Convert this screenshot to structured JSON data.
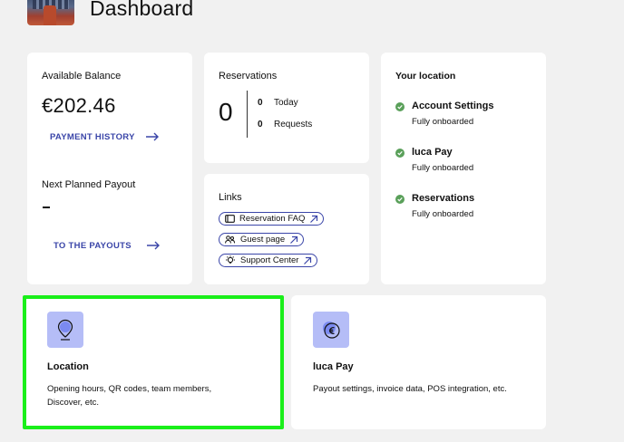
{
  "header": {
    "title": "Dashboard"
  },
  "balance": {
    "available_label": "Available Balance",
    "amount": "€202.46",
    "payment_history_label": "PAYMENT HISTORY",
    "next_payout_label": "Next Planned Payout",
    "next_payout_value": "–",
    "to_payouts_label": "TO THE PAYOUTS"
  },
  "reservations": {
    "label": "Reservations",
    "total": "0",
    "today_count": "0",
    "today_label": "Today",
    "requests_count": "0",
    "requests_label": "Requests"
  },
  "links": {
    "label": "Links",
    "items": [
      {
        "label": "Reservation FAQ",
        "icon": "ticket-icon"
      },
      {
        "label": "Guest page",
        "icon": "guests-icon"
      },
      {
        "label": "Support Center",
        "icon": "lightbulb-icon"
      }
    ]
  },
  "location_status": {
    "title": "Your location",
    "items": [
      {
        "name": "Account Settings",
        "status": "Fully onboarded"
      },
      {
        "name": "luca Pay",
        "status": "Fully onboarded"
      },
      {
        "name": "Reservations",
        "status": "Fully onboarded"
      }
    ]
  },
  "tiles": {
    "location": {
      "title": "Location",
      "description": "Opening hours, QR codes, team members, Discover, etc.",
      "icon": "location-pin-icon"
    },
    "luca_pay": {
      "title": "luca Pay",
      "description": "Payout settings, invoice data, POS integration, etc.",
      "icon": "euro-coin-icon"
    }
  },
  "colors": {
    "accent": "#3a45a8",
    "icon_bg": "#b5bdf7",
    "check": "#5aa05a",
    "highlight": "#1aef1a",
    "background": "#f1f1f1"
  }
}
